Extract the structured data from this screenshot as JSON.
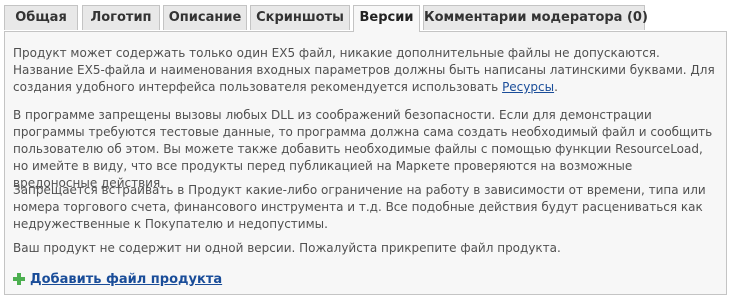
{
  "tabs": [
    {
      "label": "Общая"
    },
    {
      "label": "Логотип"
    },
    {
      "label": "Описание"
    },
    {
      "label": "Скриншоты"
    },
    {
      "label": "Версии"
    },
    {
      "label": "Комментарии модератора (0)"
    }
  ],
  "active_tab": "Версии",
  "content": {
    "p1_text": "Продукт может содержать только один EX5 файл, никакие дополнительные файлы не допускаются. Название EX5-файла и наименования входных параметров должны быть написаны латинскими буквами. Для создания удобного интерфейса пользователя рекомендуется использовать ",
    "p1_link": "Ресурсы",
    "p1_end": ".",
    "p2": "В программе запрещены вызовы любых DLL из соображений безопасности. Если для демонстрации программы требуются тестовые данные, то программа должна сама создать необходимый файл и сообщить пользователю об этом. Вы можете также добавить необходимые файлы с помощью функции ResourceLoad, но имейте в виду, что все продукты перед публикацией на Маркете проверяются на возможные вредоносные действия.",
    "p3": "Запрещается встраивать в Продукт какие-либо ограничение на работу в зависимости от времени, типа или номера торгового счета, финансового инструмента и т.д. Все подобные действия будут расцениваться как недружественные к Покупателю и недопустимы.",
    "p4": "Ваш продукт не содержит ни одной версии. Пожалуйста прикрепите файл продукта."
  },
  "add_file": {
    "label": "Добавить файл продукта",
    "icon": "plus-icon",
    "icon_color": "#4caf50"
  },
  "colors": {
    "tab_bg": "#e8e8e8",
    "active_tab_bg": "#f7f7f7",
    "border": "#c4c4c4",
    "text": "#505050",
    "link": "#1a4d99"
  }
}
